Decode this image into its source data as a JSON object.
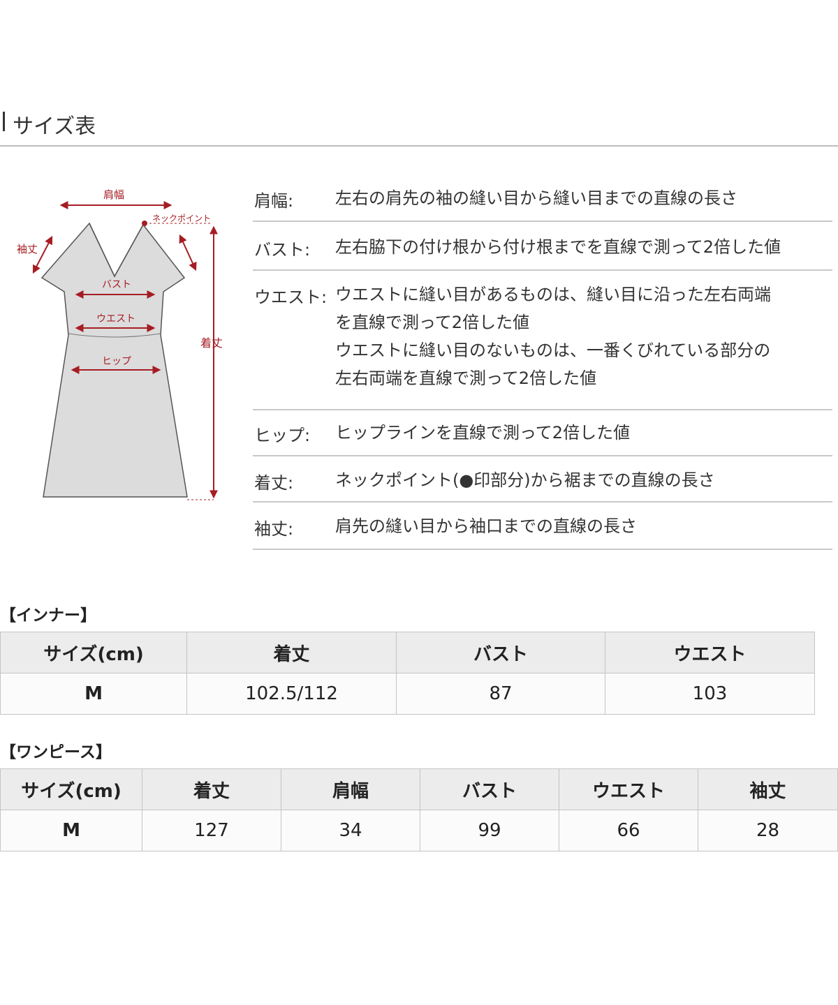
{
  "header": {
    "title": "サイズ表"
  },
  "diagram": {
    "labels": {
      "shoulder": "肩幅",
      "neck_point": "ネックポイント",
      "sleeve": "袖丈",
      "bust": "バスト",
      "waist": "ウエスト",
      "hip": "ヒップ",
      "length": "着丈"
    },
    "colors": {
      "garment": "#dcdcdc",
      "outline": "#555555",
      "accent": "#a51d23"
    }
  },
  "definitions": [
    {
      "term": "肩幅:",
      "lines": [
        "左右の肩先の袖の縫い目から縫い目までの直線の長さ"
      ]
    },
    {
      "term": "バスト:",
      "lines": [
        "左右脇下の付け根から付け根までを直線で測って2倍した値"
      ]
    },
    {
      "term": "ウエスト:",
      "lines": [
        "ウエストに縫い目があるものは、縫い目に沿った左右両端",
        "を直線で測って2倍した値",
        "ウエストに縫い目のないものは、一番くびれている部分の",
        "左右両端を直線で測って2倍した値"
      ]
    },
    {
      "term": "ヒップ:",
      "lines": [
        "ヒップラインを直線で測って2倍した値"
      ]
    },
    {
      "term": "着丈:",
      "lines": [
        "ネックポイント(●印部分)から裾までの直線の長さ"
      ]
    },
    {
      "term": "袖丈:",
      "lines": [
        "肩先の縫い目から袖口までの直線の長さ"
      ]
    }
  ],
  "inner_table": {
    "label": "【インナー】",
    "headers": [
      "サイズ(cm)",
      "着丈",
      "バスト",
      "ウエスト"
    ],
    "rows": [
      [
        "M",
        "102.5/112",
        "87",
        "103"
      ]
    ]
  },
  "onepiece_table": {
    "label": "【ワンピース】",
    "headers": [
      "サイズ(cm)",
      "着丈",
      "肩幅",
      "バスト",
      "ウエスト",
      "袖丈"
    ],
    "rows": [
      [
        "M",
        "127",
        "34",
        "99",
        "66",
        "28"
      ]
    ]
  }
}
